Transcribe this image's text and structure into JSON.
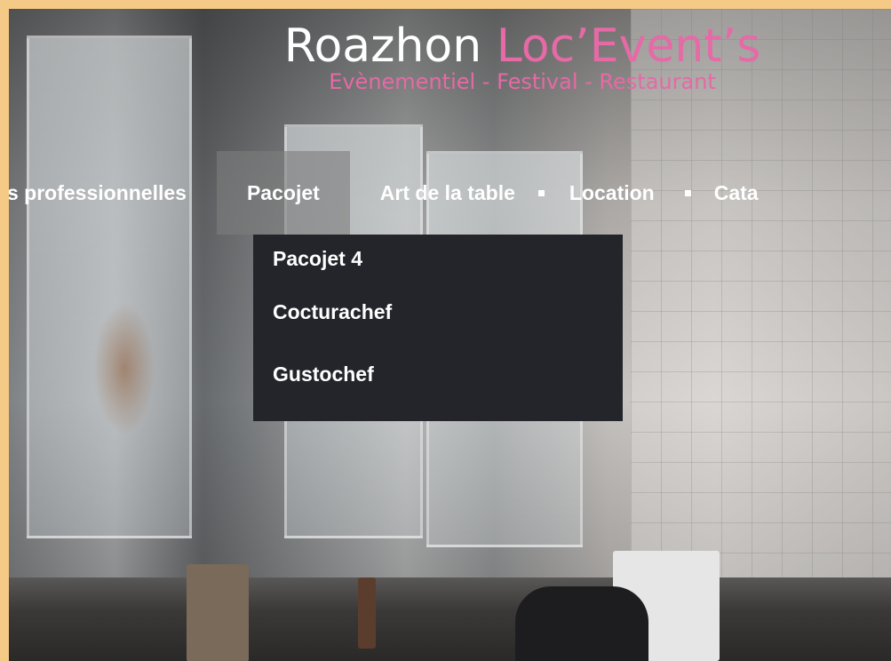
{
  "logo": {
    "name_part1": "Roazhon",
    "name_part2": "Loc’Event’s",
    "tagline": "Evènementiel - Festival - Restaurant"
  },
  "nav": {
    "items": [
      {
        "label": "s professionnelles"
      },
      {
        "label": "Pacojet"
      },
      {
        "label": "Art de la table"
      },
      {
        "label": "Location"
      },
      {
        "label": "Cata"
      }
    ]
  },
  "dropdown": {
    "items": [
      {
        "label": "Pacojet 4"
      },
      {
        "label": "Cocturachef"
      },
      {
        "label": "Gustochef"
      }
    ]
  },
  "colors": {
    "brand_pink": "#e56aa6",
    "frame": "#f5c986",
    "dropdown_bg": "#24252a",
    "active_nav_bg": "rgba(125,125,125,0.6)"
  }
}
